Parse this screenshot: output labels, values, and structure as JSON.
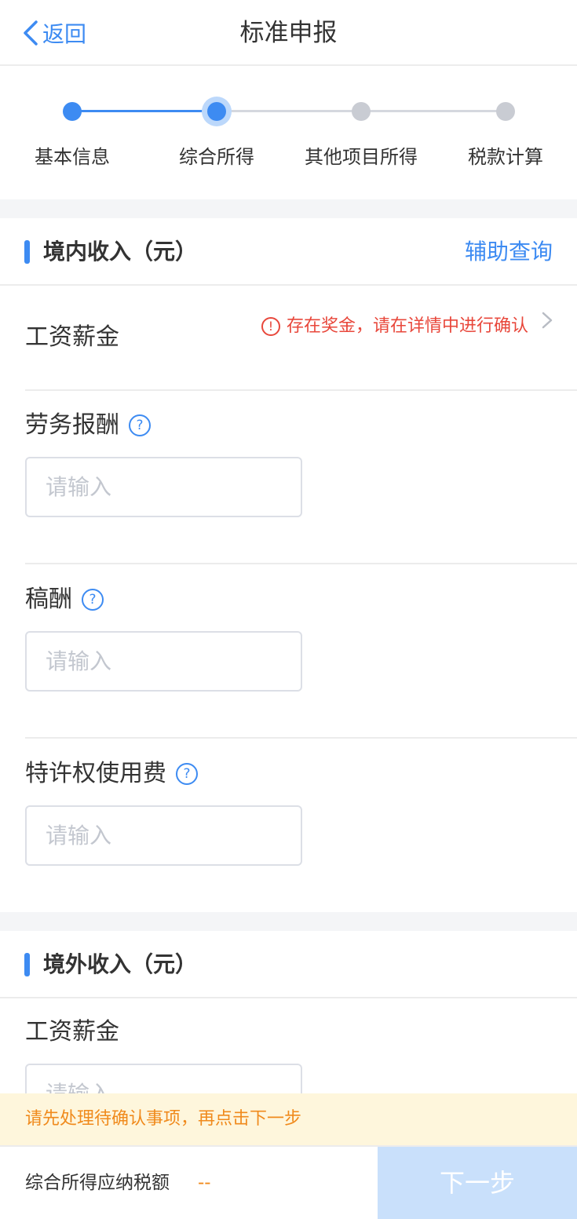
{
  "nav": {
    "back_label": "返回",
    "title": "标准申报"
  },
  "steps": [
    {
      "label": "基本信息",
      "state": "done"
    },
    {
      "label": "综合所得",
      "state": "current"
    },
    {
      "label": "其他项目所得",
      "state": "todo"
    },
    {
      "label": "税款计算",
      "state": "todo"
    }
  ],
  "domestic": {
    "title": "境内收入（元）",
    "assist_label": "辅助查询",
    "salary_label": "工资薪金",
    "salary_warning_icon": "!",
    "salary_warning": "存在奖金，请在详情中进行确认",
    "fields": [
      {
        "label": "劳务报酬",
        "help": "?",
        "value": "",
        "placeholder": "请输入"
      },
      {
        "label": "稿酬",
        "help": "?",
        "value": "",
        "placeholder": "请输入"
      },
      {
        "label": "特许权使用费",
        "help": "?",
        "value": "",
        "placeholder": "请输入"
      }
    ]
  },
  "foreign": {
    "title": "境外收入（元）",
    "salary_label": "工资薪金",
    "salary_value": "",
    "salary_placeholder": "请输入"
  },
  "notice": "请先处理待确认事项，再点击下一步",
  "bottom": {
    "tax_label": "综合所得应纳税额",
    "tax_value": "--",
    "next_label": "下一步"
  },
  "colors": {
    "primary": "#3d8bf2",
    "warning": "#e8473b",
    "notice_text": "#f08a1c",
    "notice_bg": "#fef6dc",
    "button_disabled": "#c9e0fb"
  }
}
